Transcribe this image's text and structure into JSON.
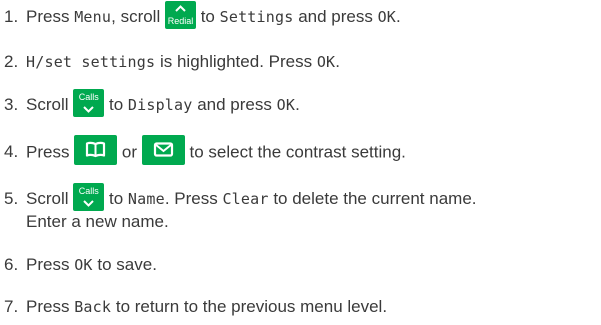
{
  "steps": [
    {
      "num": "1.",
      "t1": "Press ",
      "menu": "Menu",
      "t2": ", scroll ",
      "key": "Redial",
      "t3": " to ",
      "settings": "Settings",
      "t4": " and press ",
      "ok": "OK",
      "t5": "."
    },
    {
      "num": "2.",
      "hset": "H/set settings",
      "t1": " is highlighted. Press ",
      "ok": "OK",
      "t2": "."
    },
    {
      "num": "3.",
      "t1": "Scroll ",
      "key": "Calls",
      "t2": " to ",
      "display": "Display",
      "t3": " and press ",
      "ok": "OK",
      "t4": "."
    },
    {
      "num": "4.",
      "t1": "Press ",
      "t2": " or ",
      "t3": " to select the contrast setting."
    },
    {
      "num": "5.",
      "t1": "Scroll ",
      "key": "Calls",
      "t2": " to ",
      "name": "Name",
      "t3": ". Press ",
      "clear": "Clear",
      "t4": " to delete the current name.",
      "t5": "Enter a new name."
    },
    {
      "num": "6.",
      "t1": "Press ",
      "ok": "OK",
      "t2": " to save."
    },
    {
      "num": "7.",
      "t1": "Press ",
      "back": "Back",
      "t2": " to return to the previous menu level."
    }
  ],
  "icons": {
    "key_up": "chevron-up-icon",
    "key_down": "chevron-down-icon",
    "phonebook": "phonebook-book-icon",
    "sms": "envelope-icon"
  },
  "colors": {
    "key_bg": "#00a94f",
    "text": "#3a3a3a"
  }
}
